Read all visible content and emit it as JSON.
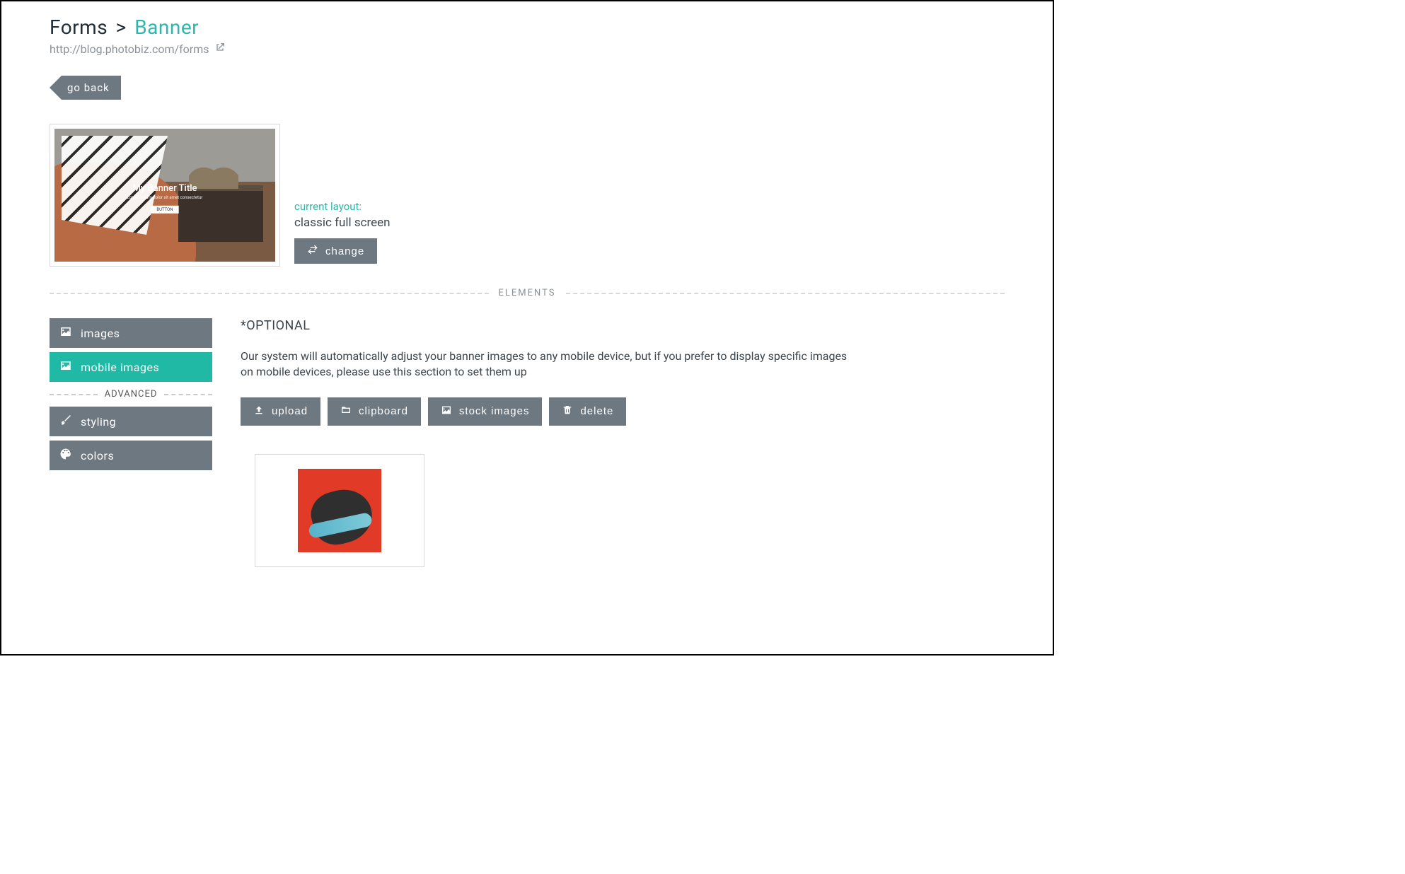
{
  "breadcrumb": {
    "root": "Forms",
    "separator": ">",
    "current": "Banner"
  },
  "url": "http://blog.photobiz.com/forms",
  "goback_label": "go back",
  "preview": {
    "banner_title": "My Banner Title",
    "banner_button": "BUTTON"
  },
  "layout": {
    "label": "current layout:",
    "value": "classic full screen",
    "change_label": "change"
  },
  "divider_label": "ELEMENTS",
  "sidebar": {
    "images": "images",
    "mobile_images": "mobile images",
    "advanced_label": "ADVANCED",
    "styling": "styling",
    "colors": "colors"
  },
  "content": {
    "optional": "*OPTIONAL",
    "description": "Our system will automatically adjust your banner images to any mobile device, but if you prefer to display specific images on mobile devices, please use this section to set them up",
    "actions": {
      "upload": "upload",
      "clipboard": "clipboard",
      "stock": "stock images",
      "delete": "delete"
    }
  }
}
